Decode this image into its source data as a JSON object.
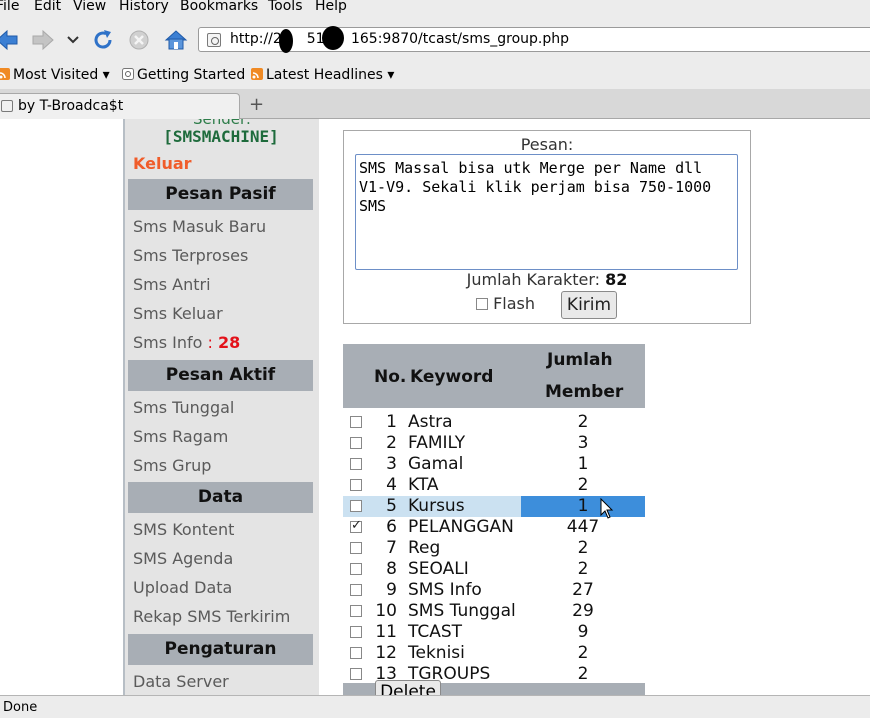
{
  "menu": [
    "File",
    "Edit",
    "View",
    "History",
    "Bookmarks",
    "Tools",
    "Help"
  ],
  "navigation": {
    "url_prefix": "http://20",
    "url_mid": "51.",
    "url_suffix": "165:9870/tcast/sms_group.php"
  },
  "bookmarks": [
    "Most Visited",
    "Getting Started",
    "Latest Headlines"
  ],
  "tab": {
    "title": "by T-Broadca$t"
  },
  "sidebar": {
    "sender_label": "Sender:",
    "machine": "[SMSMACHINE]",
    "logout": "Keluar",
    "sections": [
      {
        "title": "Pesan Pasif",
        "items": [
          "Sms Masuk Baru",
          "Sms Terproses",
          "Sms Antri",
          "Sms Keluar"
        ]
      },
      {
        "title": "Pesan Aktif",
        "items": [
          "Sms Tunggal",
          "Sms Ragam",
          "Sms Grup"
        ]
      },
      {
        "title": "Data",
        "items": [
          "SMS Kontent",
          "SMS Agenda",
          "Upload Data",
          "Rekap SMS Terkirim"
        ]
      },
      {
        "title": "Pengaturan",
        "items": [
          "Data Server"
        ]
      }
    ],
    "sms_info": {
      "label": "Sms Info",
      "colon": " : ",
      "count": "28"
    }
  },
  "compose": {
    "label": "Pesan:",
    "message": "SMS Massal bisa utk Merge per Name dll V1-V9. Sekali klik perjam bisa 750-1000 SMS",
    "char_count_label": "Jumlah Karakter:",
    "char_count": "82",
    "flash_label": "Flash",
    "flash_checked": false,
    "send_button": "Kirim"
  },
  "keyword_table": {
    "headers": {
      "no": "No.",
      "keyword": "Keyword",
      "member_line1": "Jumlah",
      "member_line2": "Member"
    },
    "rows": [
      {
        "no": "1",
        "keyword": "Astra",
        "member": "2",
        "checked": false
      },
      {
        "no": "2",
        "keyword": "FAMILY",
        "member": "3",
        "checked": false
      },
      {
        "no": "3",
        "keyword": "Gamal",
        "member": "1",
        "checked": false
      },
      {
        "no": "4",
        "keyword": "KTA",
        "member": "2",
        "checked": false
      },
      {
        "no": "5",
        "keyword": "Kursus",
        "member": "1",
        "checked": false,
        "highlighted": true
      },
      {
        "no": "6",
        "keyword": "PELANGGAN",
        "member": "447",
        "checked": true
      },
      {
        "no": "7",
        "keyword": "Reg",
        "member": "2",
        "checked": false
      },
      {
        "no": "8",
        "keyword": "SEOALI",
        "member": "2",
        "checked": false
      },
      {
        "no": "9",
        "keyword": "SMS Info",
        "member": "27",
        "checked": false
      },
      {
        "no": "10",
        "keyword": "SMS Tunggal",
        "member": "29",
        "checked": false
      },
      {
        "no": "11",
        "keyword": "TCAST",
        "member": "9",
        "checked": false
      },
      {
        "no": "12",
        "keyword": "Teknisi",
        "member": "2",
        "checked": false
      },
      {
        "no": "13",
        "keyword": "TGROUPS",
        "member": "2",
        "checked": false
      }
    ],
    "delete_button": "Delete"
  },
  "status": {
    "text": "Done"
  },
  "colors": {
    "chrome_bg": "#ececec",
    "sidebar_bg": "#e4e4e4",
    "section_header_bg": "#a8aeb5",
    "logout": "#f05c2a",
    "machine": "#1e6b3c",
    "info_count": "#e3121a",
    "selection": "#3d8edb",
    "selection_light": "#cbe1f1"
  },
  "icons": [
    "back-arrow-icon",
    "forward-arrow-icon",
    "history-dropdown-icon",
    "reload-icon",
    "stop-icon",
    "home-icon",
    "page-favicon",
    "rss-icon",
    "new-tab-plus-icon",
    "mouse-cursor-icon"
  ]
}
